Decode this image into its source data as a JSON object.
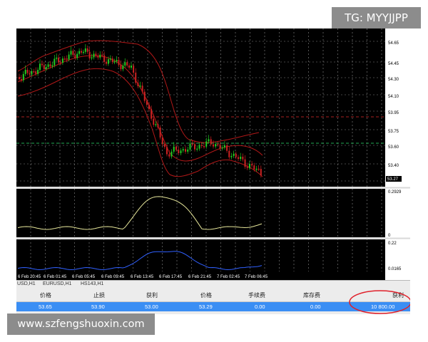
{
  "watermark": {
    "top_right": "TG: MYYJJPP",
    "bottom_left": "www.szfengshuoxin.com"
  },
  "chart": {
    "price_labels": [
      "54.65",
      "54.45",
      "54.30",
      "54.10",
      "53.95",
      "53.75",
      "53.60",
      "53.40"
    ],
    "current_price": "53.27",
    "indicator1_labels": [
      "0.2929",
      "0"
    ],
    "indicator2_labels": [
      "0.22",
      "0.0165"
    ],
    "time_labels": [
      "6 Feb 20:45",
      "6 Feb 01:45",
      "6 Feb 05:45",
      "6 Feb 09:45",
      "6 Feb 13:45",
      "6 Feb 17:45",
      "6 Feb 21:45",
      "7 Feb 02:45",
      "7 Feb 06:45"
    ],
    "colors": {
      "background": "#000000",
      "grid": "#9a9a9a",
      "bands": "#b01818",
      "bull": "#22cc22",
      "bear": "#cc2222",
      "indicator1": "#e6e69a",
      "indicator2": "#3060ff"
    }
  },
  "tabs": [
    "USD,H1",
    "EURUSD,H1",
    "HS143,H1"
  ],
  "table": {
    "headers": [
      "价格",
      "止损",
      "获利",
      "价格",
      "手续费",
      "库存费",
      "获利"
    ],
    "row": [
      "53.65",
      "53.90",
      "53.00",
      "53.29",
      "0.00",
      "0.00",
      "10 800.00"
    ]
  }
}
